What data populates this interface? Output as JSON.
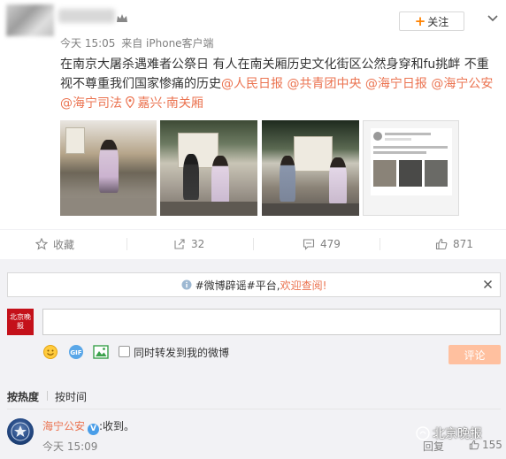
{
  "post": {
    "follow_label": "关注",
    "meta_time": "今天 15:05",
    "meta_source": "来自 iPhone客户端",
    "text_main": "在南京大屠杀遇难者公祭日 有人在南关厢历史文化街区公然身穿和fu挑衅 不重视不尊重我们国家惨痛的历史",
    "mentions": [
      "@人民日报",
      "@共青团中央",
      "@海宁日报",
      "@海宁公安",
      "@海宁司法"
    ],
    "location": "嘉兴·南关厢",
    "photos": [
      "street-photo-1",
      "street-photo-2",
      "street-photo-3",
      "screenshot-photo-4"
    ]
  },
  "actions": {
    "favorite_label": "收藏",
    "repost_count": "32",
    "comment_count": "479",
    "like_count": "871"
  },
  "comment_box": {
    "notice_prefix": "#微博辟谣#平台,",
    "notice_link": "欢迎查阅!",
    "avatar_text": "北京晚报",
    "repost_option_label": "同时转发到我的微博",
    "submit_label": "评论"
  },
  "sort": {
    "by_hot": "按热度",
    "by_time": "按时间"
  },
  "comments": [
    {
      "user": "海宁公安",
      "verified": true,
      "text": ":收到。",
      "time": "今天 15:09",
      "reply_label": "回复",
      "likes": "155"
    }
  ],
  "watermark": "北京晚报",
  "colors": {
    "accent": "#eb7350",
    "follow_plus": "#ff8200",
    "submit_disabled": "#ffc09f",
    "panel_bg": "#f2f2f5"
  }
}
